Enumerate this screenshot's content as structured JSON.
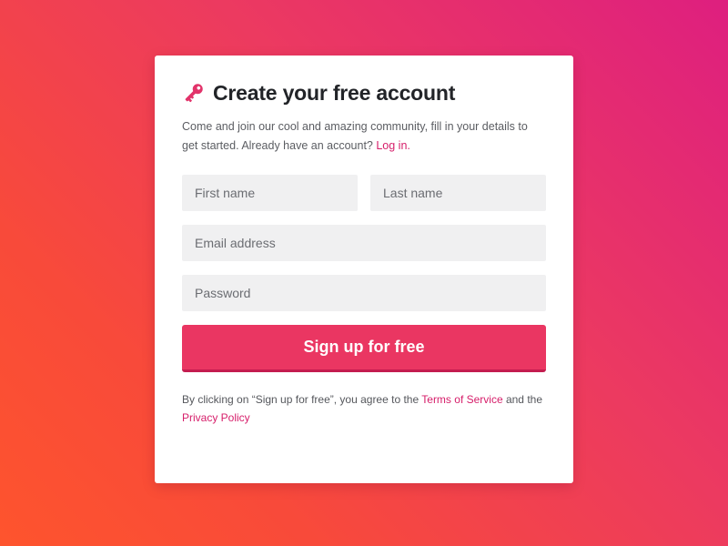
{
  "colors": {
    "accent": "#ea3662",
    "link": "#d61e6a",
    "background_top_right": "#de1f7f",
    "background_bottom_left": "#fe542d",
    "field_background": "#f0f0f1"
  },
  "header": {
    "icon": "key-icon",
    "title": "Create your free account"
  },
  "intro": {
    "text": "Come and join our cool and amazing community, fill in your details to get started. Already have an account? ",
    "login_link": "Log in."
  },
  "form": {
    "first_name": {
      "placeholder": "First name",
      "value": ""
    },
    "last_name": {
      "placeholder": "Last name",
      "value": ""
    },
    "email": {
      "placeholder": "Email address",
      "value": ""
    },
    "password": {
      "placeholder": "Password",
      "value": ""
    },
    "submit_label": "Sign up for free"
  },
  "legal": {
    "prefix": "By clicking on “Sign up for free”, you agree to the ",
    "terms_link": "Terms of Service",
    "middle": " and the ",
    "privacy_link": "Privacy Policy"
  }
}
